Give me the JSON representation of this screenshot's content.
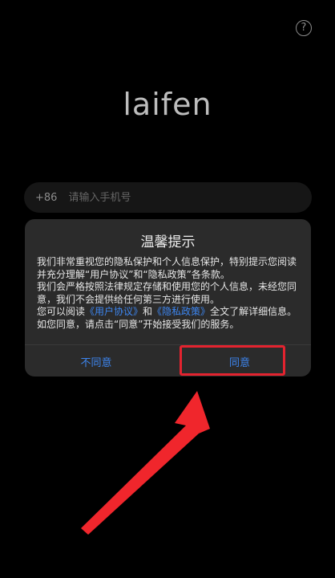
{
  "header": {
    "help_icon": "question-circle-icon",
    "help_glyph": "?"
  },
  "brand": {
    "logo_text": "laifen"
  },
  "phone": {
    "prefix": "+86",
    "placeholder": "请输入手机号"
  },
  "dialog": {
    "title": "温馨提示",
    "para1": "我们非常重视您的隐私保护和个人信息保护，特别提示您阅读并充分理解“用户协议”和“隐私政策”各条款。",
    "para2": "我们会严格按照法律规定存储和使用您的个人信息，未经您同意，我们不会提供给任何第三方进行使用。",
    "para3_before": "您可以阅读",
    "link_user_agreement": "《用户协议》",
    "para3_and": "和",
    "link_privacy_policy": "《隐私政策》",
    "para3_after": "全文了解详细信息。如您同意，请点击“同意”开始接受我们的服务。",
    "disagree_label": "不同意",
    "agree_label": "同意"
  },
  "annotation": {
    "highlight_color": "#e3232f",
    "arrow_color": "#f0262c"
  },
  "colors": {
    "link": "#3d86f0",
    "dialog_bg": "#2b2b2b"
  }
}
